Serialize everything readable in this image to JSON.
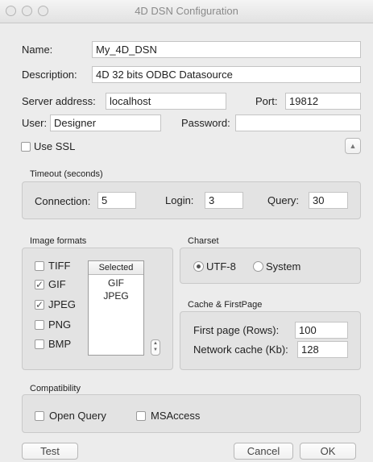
{
  "window": {
    "title": "4D DSN Configuration"
  },
  "form": {
    "name_label": "Name:",
    "name_value": "My_4D_DSN",
    "description_label": "Description:",
    "description_value": "4D 32 bits ODBC Datasource",
    "server_label": "Server address:",
    "server_value": "localhost",
    "port_label": "Port:",
    "port_value": "19812",
    "user_label": "User:",
    "user_value": "Designer",
    "password_label": "Password:",
    "password_value": "",
    "ssl_label": "Use SSL",
    "ssl_checked": false
  },
  "timeout": {
    "title": "Timeout (seconds)",
    "connection_label": "Connection:",
    "connection_value": "5",
    "login_label": "Login:",
    "login_value": "3",
    "query_label": "Query:",
    "query_value": "30"
  },
  "image_formats": {
    "title": "Image formats",
    "options": [
      {
        "label": "TIFF",
        "checked": false
      },
      {
        "label": "GIF",
        "checked": true
      },
      {
        "label": "JPEG",
        "checked": true
      },
      {
        "label": "PNG",
        "checked": false
      },
      {
        "label": "BMP",
        "checked": false
      }
    ],
    "selected_header": "Selected",
    "selected_items": [
      "GIF",
      "JPEG"
    ]
  },
  "charset": {
    "title": "Charset",
    "options": [
      {
        "label": "UTF-8",
        "selected": true
      },
      {
        "label": "System",
        "selected": false
      }
    ]
  },
  "cache": {
    "title": "Cache & FirstPage",
    "first_page_label": "First page (Rows):",
    "first_page_value": "100",
    "network_cache_label": "Network cache (Kb):",
    "network_cache_value": "128"
  },
  "compatibility": {
    "title": "Compatibility",
    "open_query_label": "Open Query",
    "msaccess_label": "MSAccess"
  },
  "buttons": {
    "test": "Test",
    "cancel": "Cancel",
    "ok": "OK"
  },
  "icons": {
    "collapse": "triangle-up-icon",
    "stepper": "stepper-icon",
    "checkmark": "checkmark-icon"
  }
}
